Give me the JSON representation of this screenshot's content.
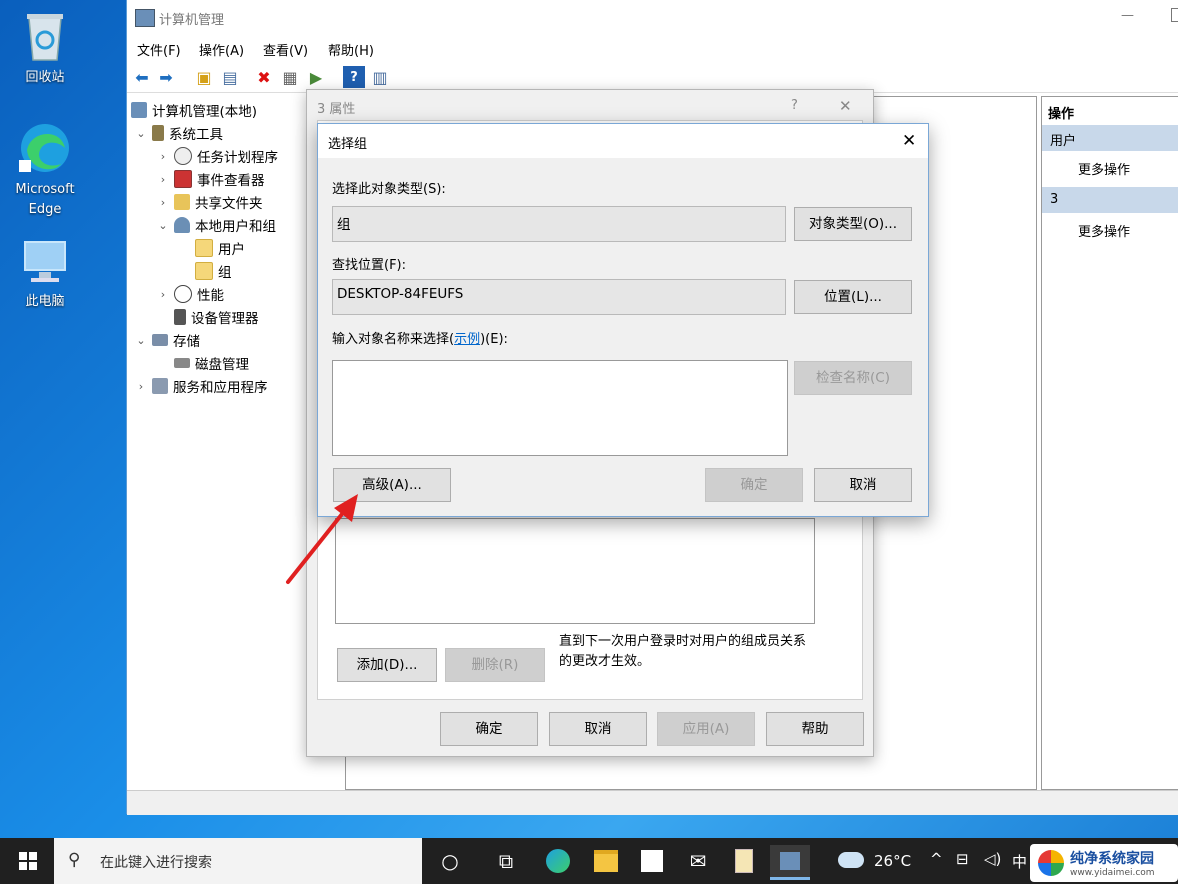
{
  "desktop": {
    "icons": [
      {
        "label": "回收站"
      },
      {
        "label": "Microsoft Edge"
      },
      {
        "label": "此电脑"
      }
    ]
  },
  "window": {
    "title": "计算机管理",
    "menu": [
      "文件(F)",
      "操作(A)",
      "查看(V)",
      "帮助(H)"
    ],
    "tree": [
      {
        "label": "计算机管理(本地)"
      },
      {
        "label": "系统工具"
      },
      {
        "label": "任务计划程序"
      },
      {
        "label": "事件查看器"
      },
      {
        "label": "共享文件夹"
      },
      {
        "label": "本地用户和组"
      },
      {
        "label": "用户"
      },
      {
        "label": "组"
      },
      {
        "label": "性能"
      },
      {
        "label": "设备管理器"
      },
      {
        "label": "存储"
      },
      {
        "label": "磁盘管理"
      },
      {
        "label": "服务和应用程序"
      }
    ],
    "actions": {
      "header": "操作",
      "section1": "用户",
      "more1": "更多操作",
      "section2": "3",
      "more2": "更多操作"
    }
  },
  "props_dialog": {
    "title": "3 属性",
    "help_glyph": "?",
    "close_glyph": "✕",
    "note": "直到下一次用户登录时对用户的组成员关系的更改才生效。",
    "add": "添加(D)...",
    "remove": "删除(R)",
    "ok": "确定",
    "cancel": "取消",
    "apply": "应用(A)",
    "help": "帮助"
  },
  "select_dialog": {
    "title": "选择组",
    "close_glyph": "✕",
    "object_type_label": "选择此对象类型(S):",
    "object_type_value": "组",
    "object_type_button": "对象类型(O)...",
    "location_label": "查找位置(F):",
    "location_value": "DESKTOP-84FEUFS",
    "location_button": "位置(L)...",
    "enter_label_pre": "输入对象名称来选择(",
    "enter_label_link": "示例",
    "enter_label_post": ")(E):",
    "check_names": "检查名称(C)",
    "advanced": "高级(A)...",
    "ok": "确定",
    "cancel": "取消"
  },
  "taskbar": {
    "search_placeholder": "在此键入进行搜索",
    "weather": "26°C",
    "ime": "中",
    "watermark": "纯净系统家园",
    "watermark_url": "www.yidaimei.com"
  },
  "colors": {
    "accent": "#0078d7",
    "annotation_arrow": "#e02020"
  }
}
